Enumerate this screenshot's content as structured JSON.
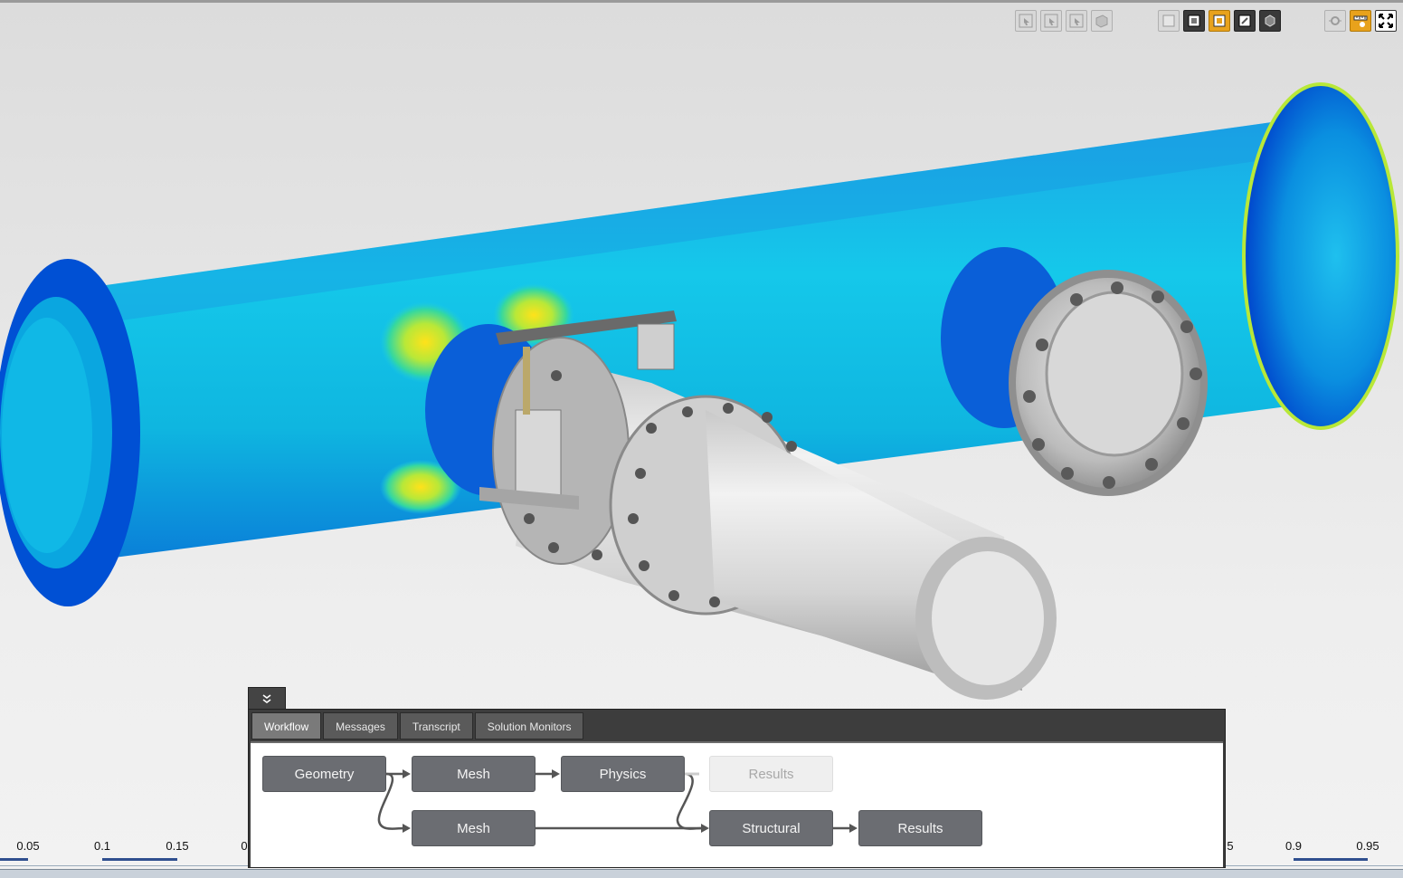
{
  "scale_bar": {
    "ticks": [
      "0.05",
      "0.1",
      "0.15",
      "0",
      "5",
      "0.9",
      "0.95"
    ]
  },
  "workflow_panel": {
    "tabs": [
      {
        "label": "Workflow",
        "active": true
      },
      {
        "label": "Messages",
        "active": false
      },
      {
        "label": "Transcript",
        "active": false
      },
      {
        "label": "Solution Monitors",
        "active": false
      }
    ],
    "nodes": {
      "geometry": "Geometry",
      "mesh_top": "Mesh",
      "physics": "Physics",
      "results_top": "Results",
      "mesh_bottom": "Mesh",
      "structural": "Structural",
      "results_bottom": "Results"
    }
  },
  "toolbar_icons": {
    "group1": [
      "select-icon",
      "select-icon",
      "select-icon",
      "box-select-icon"
    ],
    "group2": [
      "view-icon",
      "view-icon",
      "view-highlight-icon",
      "view-icon",
      "cube-icon"
    ],
    "group3": [
      "camera-icon",
      "ruler-icon",
      "fullscreen-icon"
    ]
  },
  "colors": {
    "accent_orange": "#e8a21c",
    "node_gray": "#6b6d72",
    "panel_dark": "#3d3d3d"
  }
}
